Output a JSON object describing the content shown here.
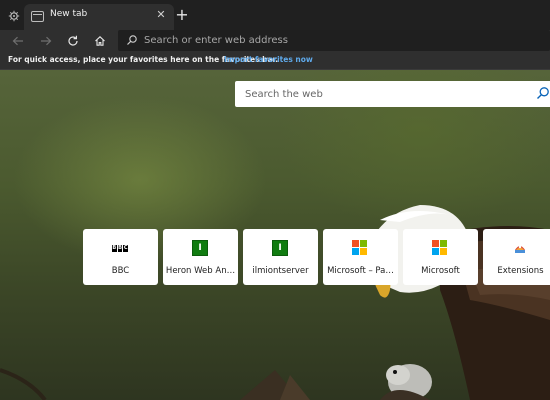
{
  "tab": {
    "title": "New tab"
  },
  "toolbar": {
    "address_placeholder": "Search or enter web address"
  },
  "favorites_bar": {
    "message": "For quick access, place your favorites here on the favorites bar.",
    "link": "Import favorites now"
  },
  "websearch": {
    "placeholder": "Search the web"
  },
  "quick_links": [
    {
      "label": "BBC",
      "icon": "bbc-logo"
    },
    {
      "label": "Heron Web An…",
      "icon": "green-square-logo",
      "glyph": "I"
    },
    {
      "label": "ilmiontserver",
      "icon": "green-square-logo",
      "glyph": "I"
    },
    {
      "label": "Microsoft – Pa…",
      "icon": "microsoft-logo"
    },
    {
      "label": "Microsoft",
      "icon": "microsoft-logo"
    },
    {
      "label": "Extensions",
      "icon": "extensions-logo"
    }
  ],
  "colors": {
    "accent_link": "#5fa9ea",
    "ms_red": "#f25022",
    "ms_green": "#7fba00",
    "ms_blue": "#00a4ef",
    "ms_yellow": "#ffb900",
    "tile_green": "#107c10"
  },
  "logos": {
    "bbc": [
      "B",
      "B",
      "C"
    ]
  }
}
